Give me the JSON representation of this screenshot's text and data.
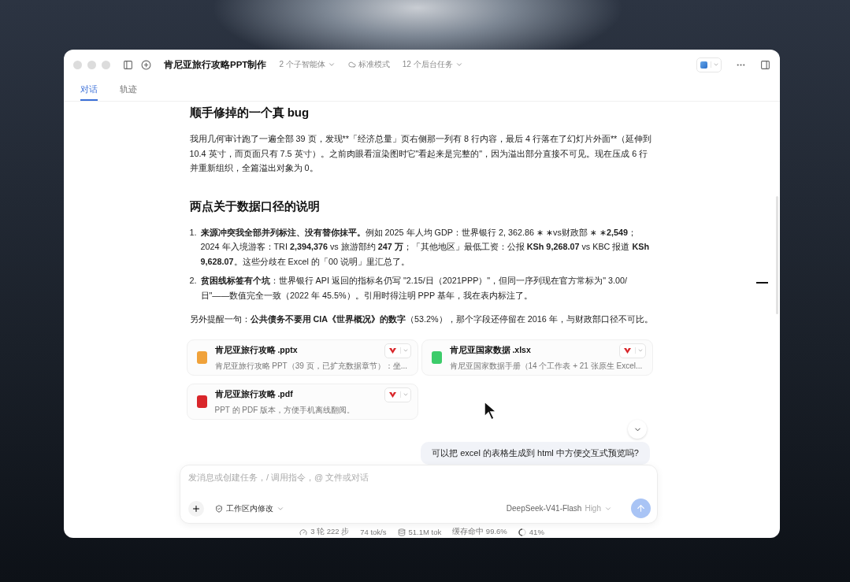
{
  "window": {
    "title": "肯尼亚旅行攻略PPT制作",
    "agents": "2 个子智能体",
    "mode": "标准模式",
    "tasks": "12 个后台任务"
  },
  "tabs": [
    {
      "label": "对话",
      "selected": true
    },
    {
      "label": "轨迹",
      "selected": false
    }
  ],
  "message": {
    "blocks": [
      {
        "kind": "heading",
        "text": "顺手修掉的一个真 bug"
      },
      {
        "kind": "paragraph",
        "text": "我用几何审计跑了一遍全部 39 页，发现**「经济总量」页右侧那一列有 8 行内容，最后 4 行落在了幻灯片外面**（延伸到 10.4 英寸，而页面只有 7.5 英寸）。之前肉眼看渲染图时它\"看起来是完整的\"，因为溢出部分直接不可见。现在压成 6 行并重新组织，全篇溢出对象为 0。"
      },
      {
        "kind": "heading",
        "text": "两点关于数据口径的说明"
      },
      {
        "kind": "list",
        "items": [
          {
            "marker": "1.",
            "text": "**来源冲突我全部并列标注、没有替你抹平。**例如 2025 年人均 GDP：世界银行 2, 362.86 ∗ ∗vs财政部 ∗ ∗**2,549**；2024 年入境游客：TRI **2,394,376** vs 旅游部约 **247 万**；「其他地区」最低工资：公报 **KSh 9,268.07** vs KBC 报道 **KSh 9,628.07**。这些分歧在 Excel 的「00 说明」里汇总了。"
          },
          {
            "marker": "2.",
            "text": "**贫困线标签有个坑**：世界银行 API 返回的指标名仍写 \"2.15/日（2021PPP）\"，但同一序列现在官方常标为\" 3.00/日\"——数值完全一致（2022 年 45.5%）。引用时得注明 PPP 基年，我在表内标注了。"
          }
        ]
      },
      {
        "kind": "paragraph",
        "text": "另外提醒一句：**公共债务不要用 CIA《世界概况》的数字**（53.2%），那个字段还停留在 2016 年，与财政部口径不可比。"
      }
    ],
    "files": [
      {
        "kind": "pptx",
        "name": "肯尼亚旅行攻略 .pptx",
        "description": "肯尼亚旅行攻略 PPT（39 页，已扩充数据章节）：坐..."
      },
      {
        "kind": "xlsx",
        "name": "肯尼亚国家数据 .xlsx",
        "description": "肯尼亚国家数据手册（14 个工作表 + 21 张原生 Excel..."
      },
      {
        "kind": "pdf",
        "name": "肯尼亚旅行攻略 .pdf",
        "description": "PPT 的 PDF 版本，方便手机离线翻阅。"
      }
    ]
  },
  "user_message": "可以把 excel 的表格生成到 html 中方便交互式预览吗?",
  "composer": {
    "placeholder": "发消息或创建任务，/ 调用指令，@ 文件或对话",
    "scope": "工作区内修改",
    "model": "DeepSeek-V41-Flash",
    "effort": "High",
    "send_disabled": true
  },
  "status_bar": {
    "steps": "3 轮 222 步",
    "speed": "74 tok/s",
    "tokens": "51.1M tok",
    "cache": "缓存命中 99.6%",
    "context": "41%"
  }
}
